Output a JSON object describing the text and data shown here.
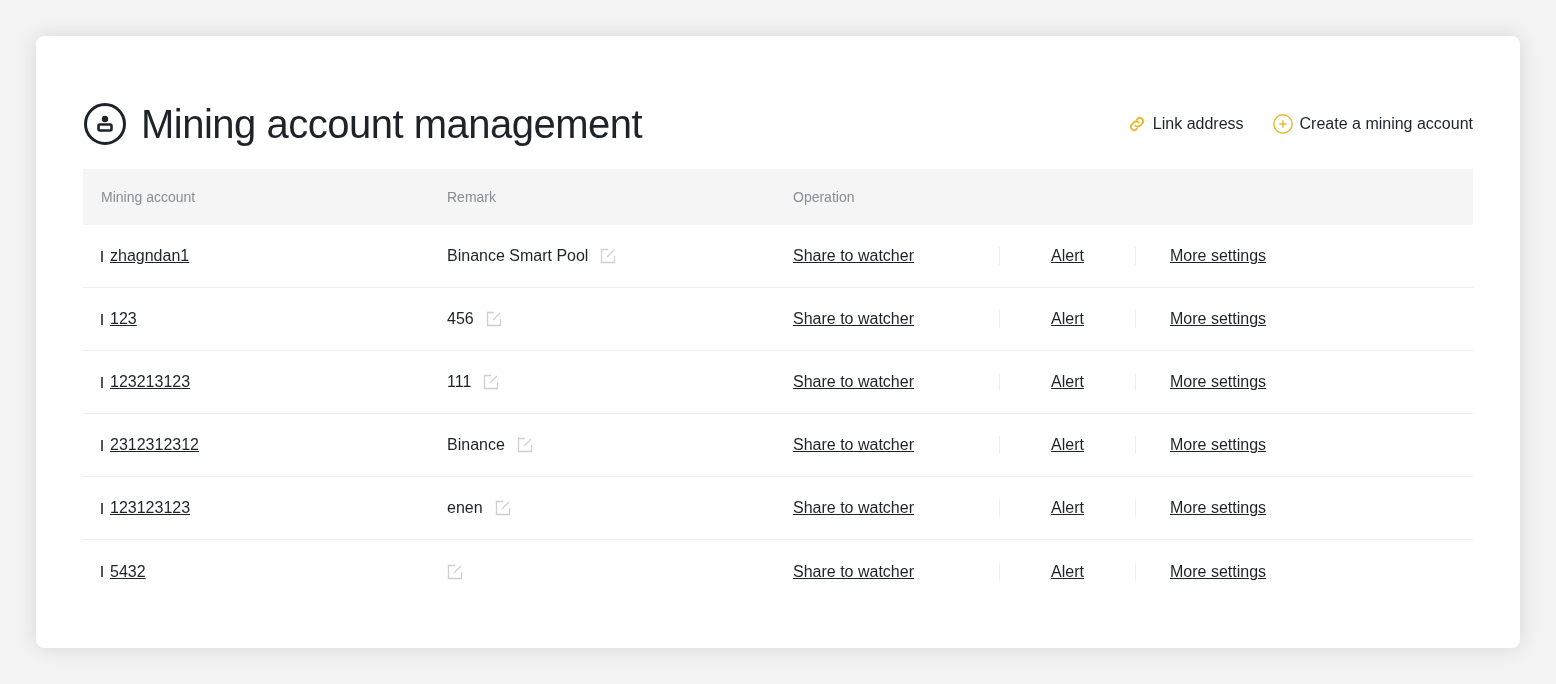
{
  "header": {
    "title": "Mining account management",
    "actions": [
      {
        "kind": "link",
        "label": "Link address"
      },
      {
        "kind": "create",
        "label": "Create a mining account"
      }
    ]
  },
  "table": {
    "columns": [
      "Mining account",
      "Remark",
      "Operation"
    ],
    "rows": [
      {
        "account": "zhagndan1",
        "remark": "Binance Smart Pool",
        "operations": [
          "Share to watcher",
          "Alert",
          "More settings"
        ]
      },
      {
        "account": "123",
        "remark": "456",
        "operations": [
          "Share to watcher",
          "Alert",
          "More settings"
        ]
      },
      {
        "account": "123213123",
        "remark": "111",
        "operations": [
          "Share to watcher",
          "Alert",
          "More settings"
        ]
      },
      {
        "account": "2312312312",
        "remark": "Binance",
        "operations": [
          "Share to watcher",
          "Alert",
          "More settings"
        ]
      },
      {
        "account": "123123123",
        "remark": "enen",
        "operations": [
          "Share to watcher",
          "Alert",
          "More settings"
        ]
      },
      {
        "account": "5432",
        "operations": [
          "Share to watcher",
          "Alert",
          "More settings"
        ]
      }
    ]
  }
}
